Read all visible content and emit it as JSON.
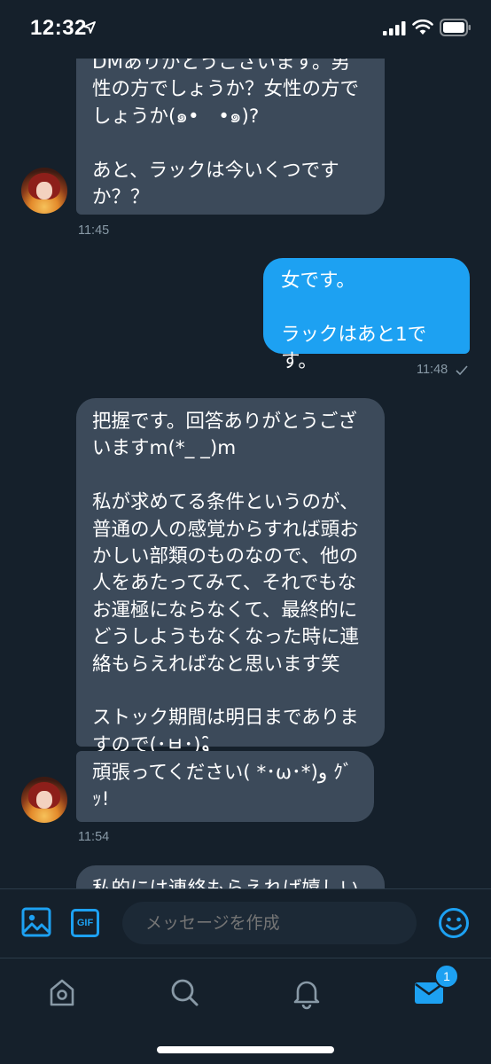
{
  "status_bar": {
    "time": "12:32"
  },
  "messages": [
    {
      "side": "received",
      "text": "DMありがとうございます。男性の方でしょうか？女性の方でしょうか(๑•　•๑)?\n\nあと、ラックは今いくつですか？？"
    },
    {
      "time": "11:45"
    },
    {
      "side": "sent",
      "text": "女です。\n\nラックはあと1です。"
    },
    {
      "time": "11:48"
    },
    {
      "side": "received",
      "text": "把握です。回答ありがとうございますm(*_ _)m\n\n私が求めてる条件というのが、普通の人の感覚からすれば頭おかしい部類のものなので、他の人をあたってみて、それでもなお運極にならなくて、最終的にどうしようもなくなった時に連絡もらえればなと思います笑\n\nストック期間は明日までありますので(･ㅂ･)و ̑̑"
    },
    {
      "side": "received",
      "text": "頑張ってください( *･ω･*)و ｸﾞｯ!"
    },
    {
      "time": "11:54"
    },
    {
      "side": "received",
      "text": "私的には連絡もらえれば嬉しいの"
    }
  ],
  "composer": {
    "gif_label": "GIF",
    "placeholder": "メッセージを作成"
  },
  "tabbar": {
    "messages_badge": "1"
  },
  "colors": {
    "background": "#15202b",
    "received_bubble": "#3c4a5a",
    "sent_bubble": "#1da1f2",
    "accent": "#1da1f2",
    "muted_text": "#8899a6"
  },
  "icons": [
    "location-arrow-icon",
    "signal-icon",
    "wifi-icon",
    "battery-icon",
    "read-check-icon",
    "image-icon",
    "gif-icon",
    "emoji-icon",
    "home-icon",
    "search-icon",
    "bell-icon",
    "envelope-icon"
  ]
}
